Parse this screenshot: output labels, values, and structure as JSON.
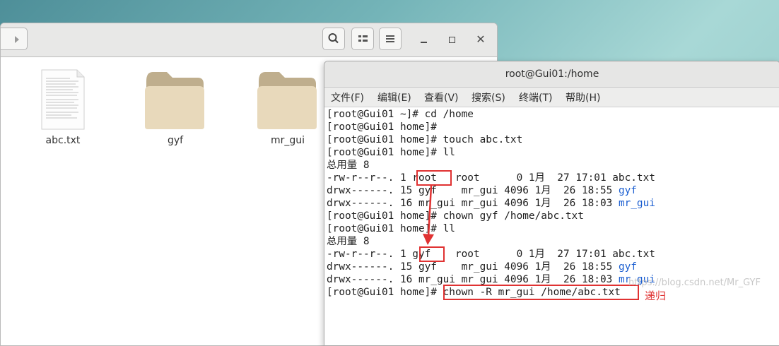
{
  "file_manager": {
    "items": [
      {
        "label": "abc.txt",
        "icon": "text-file-icon"
      },
      {
        "label": "gyf",
        "icon": "folder-icon"
      },
      {
        "label": "mr_gui",
        "icon": "folder-icon"
      }
    ]
  },
  "terminal": {
    "title": "root@Gui01:/home",
    "menu": [
      "文件(F)",
      "编辑(E)",
      "查看(V)",
      "搜索(S)",
      "终端(T)",
      "帮助(H)"
    ],
    "lines": [
      {
        "text": "[root@Gui01 ~]# cd /home"
      },
      {
        "text": "[root@Gui01 home]# "
      },
      {
        "text": "[root@Gui01 home]# touch abc.txt"
      },
      {
        "text": "[root@Gui01 home]# ll"
      },
      {
        "text": "总用量 8"
      },
      {
        "text": "-rw-r--r--. 1 root   root      0 1月  27 17:01 abc.txt"
      },
      {
        "prefix": "drwx------. 15 gyf    mr_gui 4096 1月  26 18:55 ",
        "name": "gyf"
      },
      {
        "prefix": "drwx------. 16 mr_gui mr_gui 4096 1月  26 18:03 ",
        "name": "mr_gui"
      },
      {
        "text": "[root@Gui01 home]# chown gyf /home/abc.txt"
      },
      {
        "text": "[root@Gui01 home]# ll"
      },
      {
        "text": "总用量 8"
      },
      {
        "text": "-rw-r--r--. 1 gyf    root      0 1月  27 17:01 abc.txt"
      },
      {
        "prefix": "drwx------. 15 gyf    mr_gui 4096 1月  26 18:55 ",
        "name": "gyf"
      },
      {
        "prefix": "drwx------. 16 mr_gui mr_gui 4096 1月  26 18:03 ",
        "name": "mr_gui"
      },
      {
        "text": "[root@Gui01 home]# chown -R mr_gui /home/abc.txt"
      }
    ]
  },
  "annotation": {
    "label": "递归",
    "color": "#e03232"
  },
  "watermark": "https://blog.csdn.net/Mr_GYF",
  "colors": {
    "link_blue": "#1c5fd1",
    "annotation_red": "#e03232"
  }
}
